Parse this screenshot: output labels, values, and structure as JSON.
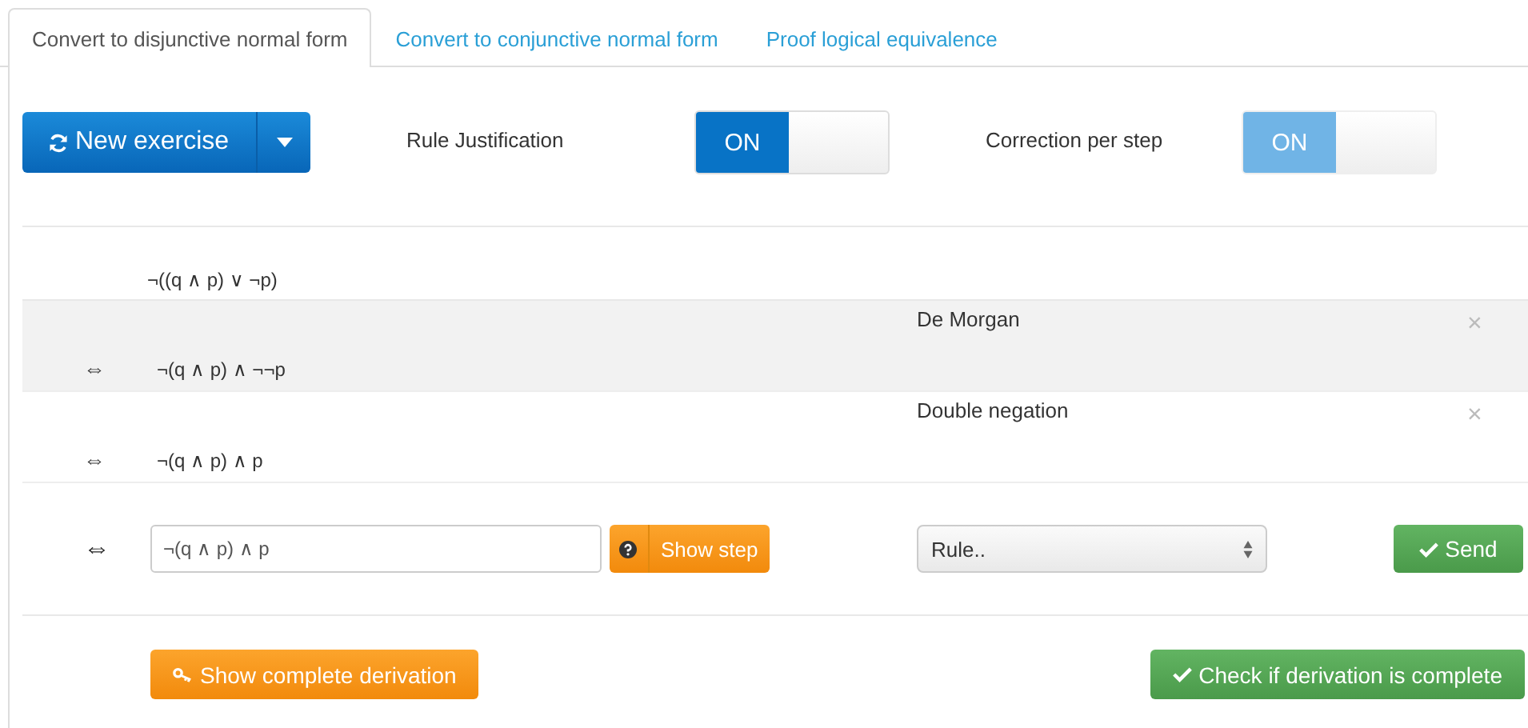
{
  "tabs": [
    {
      "label": "Convert to disjunctive normal form",
      "selected": true
    },
    {
      "label": "Convert to conjunctive normal form",
      "selected": false
    },
    {
      "label": "Proof logical equivalence",
      "selected": false
    }
  ],
  "toolbar": {
    "new_exercise": "New exercise",
    "toggles": [
      {
        "label": "Rule Justification",
        "state": "ON",
        "on": true,
        "disabled": false
      },
      {
        "label": "Correction per step",
        "state": "ON",
        "on": true,
        "disabled": true
      }
    ]
  },
  "derivation": {
    "start": "¬((q ∧ p) ∨ ¬p)",
    "steps": [
      {
        "symbol": "⇔",
        "formula": "¬(q ∧ p) ∧ ¬¬p",
        "rule": "De Morgan",
        "remove": "×",
        "highlighted": true
      },
      {
        "symbol": "⇔",
        "formula": "¬(q ∧ p) ∧ p",
        "rule": "Double negation",
        "remove": "×",
        "highlighted": false
      }
    ]
  },
  "input_row": {
    "symbol": "⇔",
    "value": "¬(q ∧ p) ∧ p",
    "show_step": "Show step",
    "rule_select": "Rule..",
    "send": "Send"
  },
  "footer": {
    "show_complete": "Show complete derivation",
    "check_complete": "Check if derivation is complete"
  }
}
